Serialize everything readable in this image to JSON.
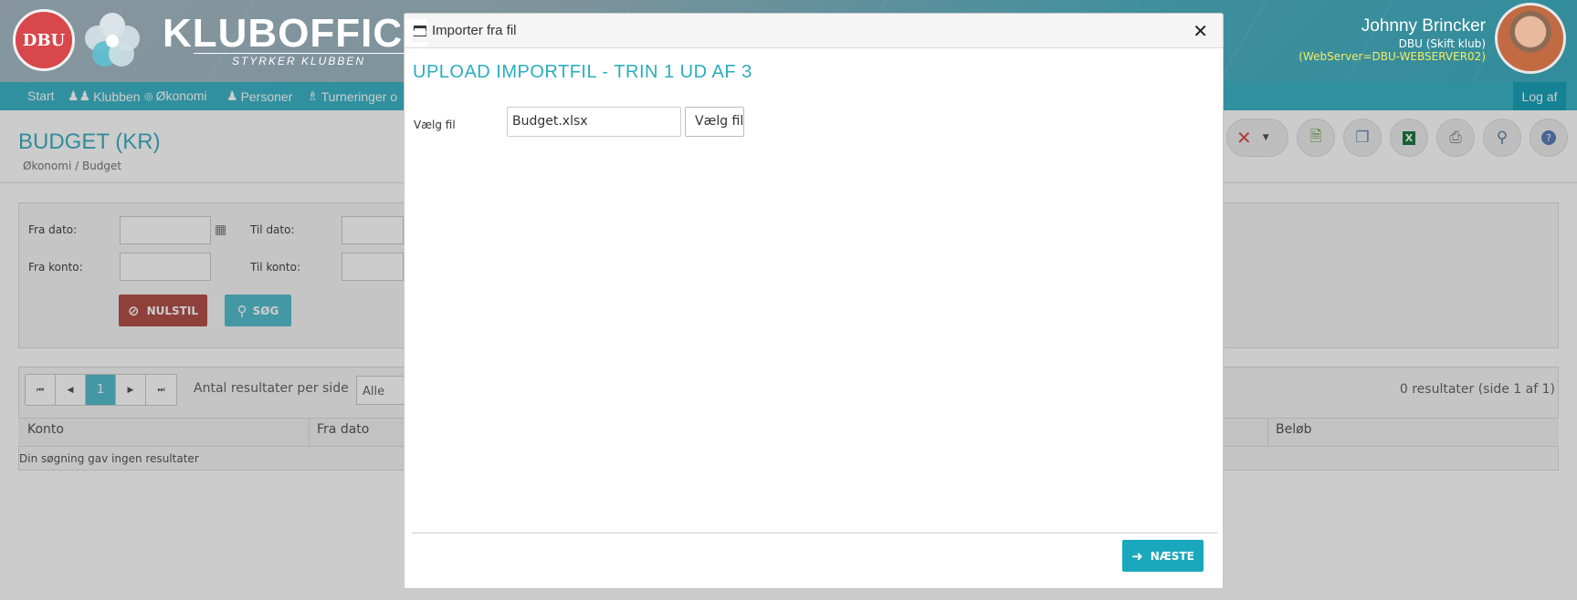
{
  "header": {
    "dbu_logo_text": "DBU",
    "app_title": "KLUBOFFICE",
    "app_subtitle": "STYRKER KLUBBEN",
    "user_name": "Johnny Brincker",
    "user_club": "DBU (Skift klub)",
    "server": "(WebServer=DBU-WEBSERVER02)"
  },
  "nav": {
    "items": [
      {
        "label": "Start",
        "icon": ""
      },
      {
        "label": "Klubben",
        "icon": "people-icon"
      },
      {
        "label": "Økonomi",
        "icon": "coin-icon"
      },
      {
        "label": "Personer",
        "icon": "person-icon"
      },
      {
        "label": "Turneringer o",
        "icon": "trophy-icon"
      }
    ],
    "logout_label": "Log af"
  },
  "page": {
    "title": "BUDGET (KR)",
    "breadcrumb": "Økonomi / Budget"
  },
  "toolbar": {
    "buttons": [
      "delete-icon",
      "new-document-icon",
      "copy-icon",
      "excel-icon",
      "print-icon",
      "search-icon",
      "help-icon"
    ]
  },
  "filter": {
    "from_date_label": "Fra dato:",
    "to_date_label": "Til dato:",
    "from_account_label": "Fra konto:",
    "to_account_label": "Til konto:",
    "reset_label": "NULSTIL",
    "search_label": "SØG"
  },
  "results": {
    "current_page": "1",
    "per_page_label": "Antal resultater per side",
    "per_page_value": "Alle",
    "count_text": "0 resultater (side 1 af 1)",
    "columns": [
      "Konto",
      "Fra dato",
      "Beløb"
    ],
    "empty_text": "Din søgning gav ingen resultater"
  },
  "modal": {
    "title": "Importer fra fil",
    "heading": "UPLOAD IMPORTFIL - TRIN 1 UD AF 3",
    "file_label": "Vælg fil",
    "file_value": "Budget.xlsx",
    "file_button_label": "Vælg fil",
    "next_label": "NÆSTE"
  },
  "colors": {
    "accent": "#3fb0c2",
    "nav": "#3db5c7",
    "reset": "#b3504a",
    "next": "#1aa8bc",
    "server_text": "#f3ec63"
  }
}
